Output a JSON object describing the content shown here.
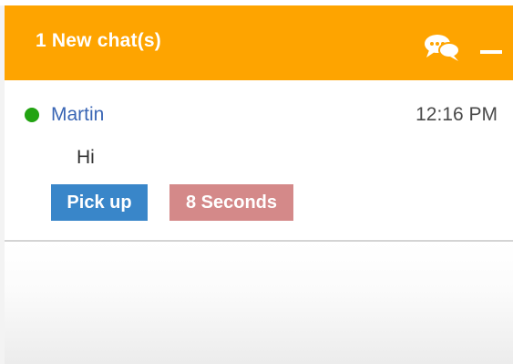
{
  "header": {
    "title": "1 New chat(s)",
    "chat_icon": "chat-bubbles-icon",
    "minimize_icon": "minimize-icon",
    "color": "#fea400"
  },
  "chat": {
    "visitor_name": "Martin",
    "status": "online",
    "status_color": "#22a312",
    "time": "12:16 PM",
    "message": "Hi",
    "pickup_label": "Pick up",
    "pickup_color": "#3986c9",
    "wait_label": "8 Seconds",
    "wait_color": "#d48989"
  }
}
